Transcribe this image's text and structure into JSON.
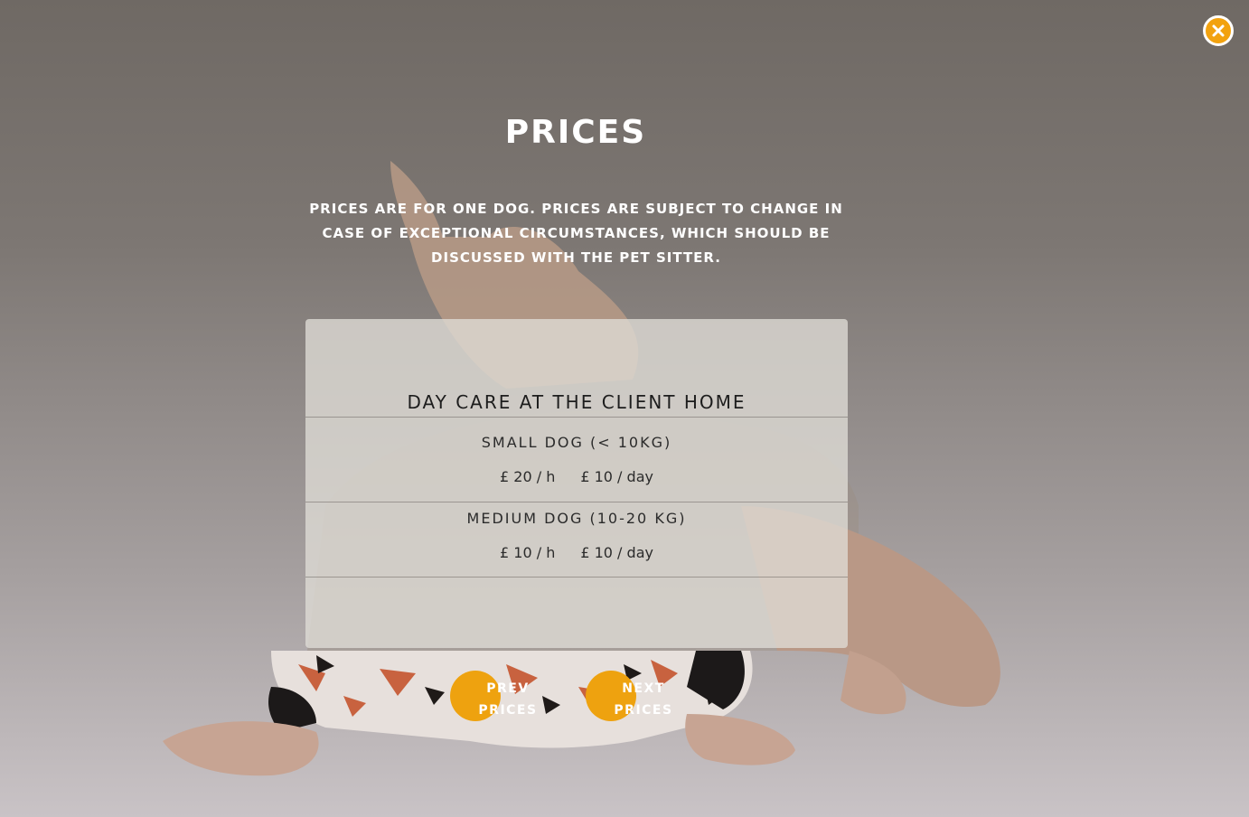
{
  "close": {
    "icon": "close-icon",
    "color": "#f2a20f"
  },
  "title": "PRICES",
  "intro": "PRICES ARE FOR ONE DOG. PRICES ARE SUBJECT TO CHANGE IN CASE OF EXCEPTIONAL CIRCUMSTANCES, WHICH SHOULD BE DISCUSSED WITH THE PET SITTER.",
  "card": {
    "title": "DAY CARE AT THE CLIENT HOME",
    "tiers": [
      {
        "name": "SMALL DOG (< 10KG)",
        "hourly": "£ 20 / h",
        "daily": "£ 10 / day"
      },
      {
        "name": "MEDIUM DOG (10-20 KG)",
        "hourly": "£ 10 / h",
        "daily": "£ 10 / day"
      }
    ]
  },
  "nav": {
    "prev_line1": "PREV",
    "prev_line2": "PRICES",
    "next_line1": "NEXT",
    "next_line2": "PRICES",
    "accent": "#eea20f"
  }
}
